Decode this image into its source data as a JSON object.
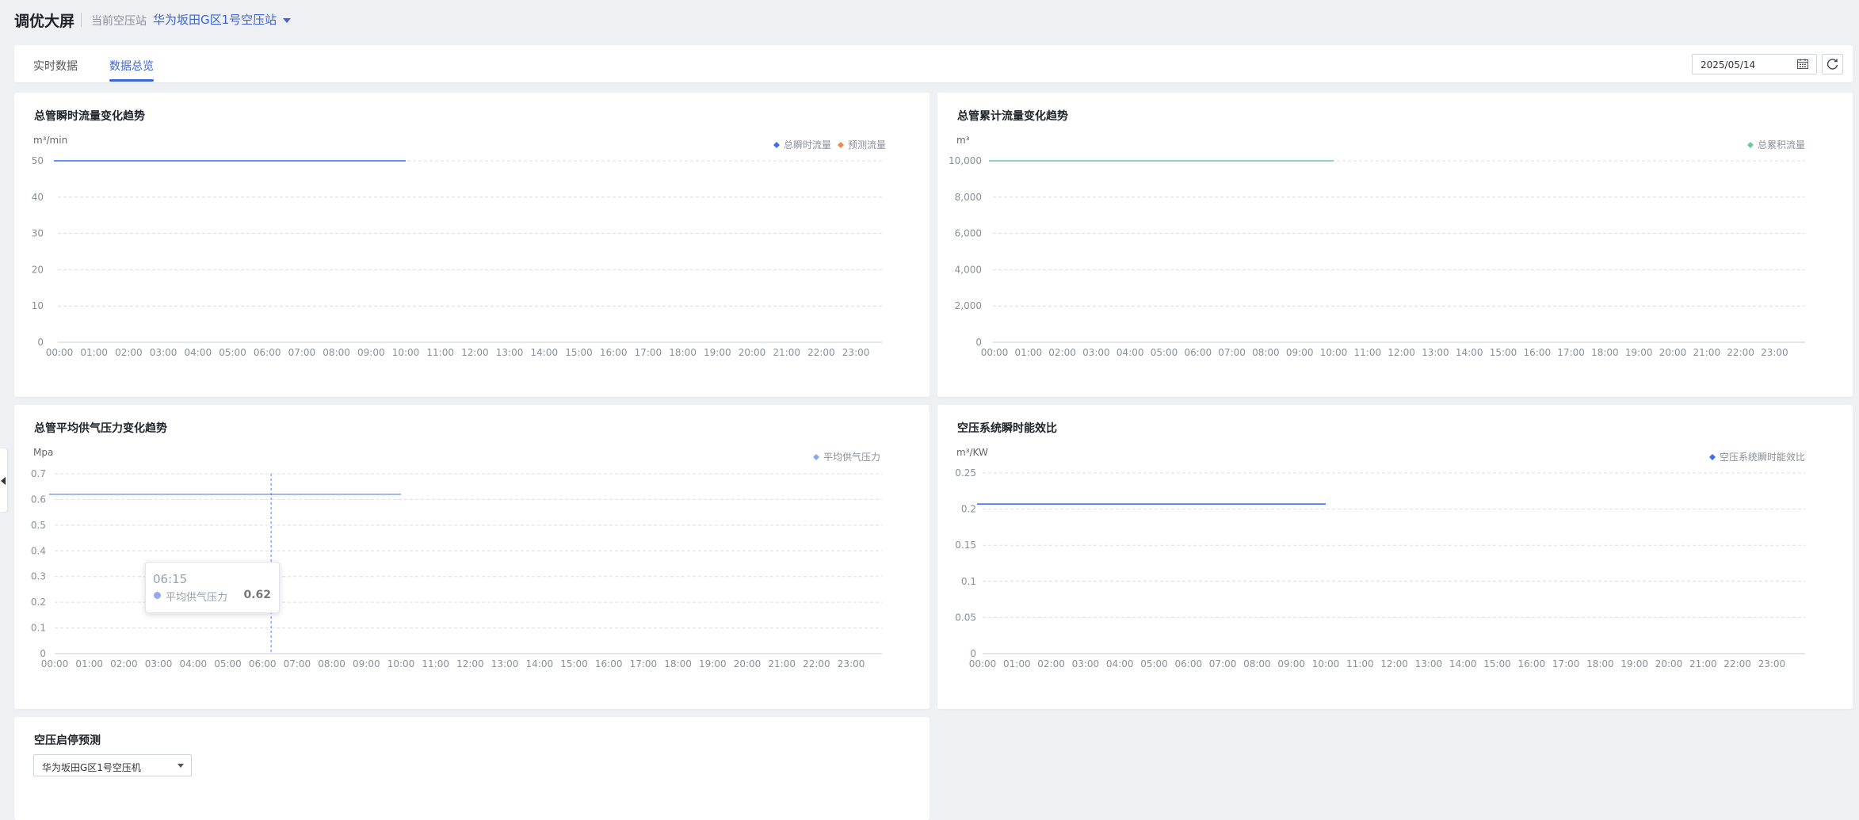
{
  "header": {
    "title": "调优大屏",
    "station_label": "当前空压站",
    "station_value": "华为坂田G区1号空压站"
  },
  "tabs": [
    {
      "label": "实时数据",
      "active": false
    },
    {
      "label": "数据总览",
      "active": true
    }
  ],
  "date_value": "2025/05/14",
  "icons": {
    "calendar": "calendar-icon",
    "refresh": "refresh-icon",
    "station_dropdown": "chevron-down-icon",
    "collapse": "chevron-left-icon"
  },
  "colors": {
    "accent": "#3b64d8",
    "flow": "#3b6ef0",
    "forecast": "#f08a4b",
    "cumulative": "#6cc9a1",
    "pressure": "#8aa6f2",
    "efficiency": "#3b6ef0"
  },
  "chart_data": [
    {
      "id": "flow",
      "type": "line",
      "title": "总管瞬时流量变化趋势",
      "ylabel": "m³/min",
      "ylim": [
        0,
        50
      ],
      "yticks": [
        "0",
        "10",
        "20",
        "30",
        "40",
        "50"
      ],
      "x_categories": [
        "00:00",
        "01:00",
        "02:00",
        "03:00",
        "04:00",
        "05:00",
        "06:00",
        "07:00",
        "08:00",
        "09:00",
        "10:00",
        "11:00",
        "12:00",
        "13:00",
        "14:00",
        "15:00",
        "16:00",
        "17:00",
        "18:00",
        "19:00",
        "20:00",
        "21:00",
        "22:00",
        "23:00"
      ],
      "legend": [
        {
          "name": "总瞬时流量",
          "color": "#3b6ef0"
        },
        {
          "name": "预测流量",
          "color": "#f08a4b"
        }
      ],
      "series": [
        {
          "name": "总瞬时流量",
          "color": "#3b6ef0",
          "x_start": "00:00",
          "x_end": "10:00",
          "value": 50
        }
      ],
      "grid": true
    },
    {
      "id": "cumulative",
      "type": "line",
      "title": "总管累计流量变化趋势",
      "ylabel": "m³",
      "ylim": [
        0,
        10000
      ],
      "yticks": [
        "0",
        "2,000",
        "4,000",
        "6,000",
        "8,000",
        "10,000"
      ],
      "x_categories": [
        "00:00",
        "01:00",
        "02:00",
        "03:00",
        "04:00",
        "05:00",
        "06:00",
        "07:00",
        "08:00",
        "09:00",
        "10:00",
        "11:00",
        "12:00",
        "13:00",
        "14:00",
        "15:00",
        "16:00",
        "17:00",
        "18:00",
        "19:00",
        "20:00",
        "21:00",
        "22:00",
        "23:00"
      ],
      "legend": [
        {
          "name": "总累积流量",
          "color": "#6cc9a1"
        }
      ],
      "series": [
        {
          "name": "总累积流量",
          "color": "#6cc9a1",
          "x_start": "00:00",
          "x_end": "10:00",
          "value": 10000
        }
      ],
      "grid": true
    },
    {
      "id": "pressure",
      "type": "line",
      "title": "总管平均供气压力变化趋势",
      "ylabel": "Mpa",
      "ylim": [
        0,
        0.7
      ],
      "yticks": [
        "0",
        "0.1",
        "0.2",
        "0.3",
        "0.4",
        "0.5",
        "0.6",
        "0.7"
      ],
      "x_categories": [
        "00:00",
        "01:00",
        "02:00",
        "03:00",
        "04:00",
        "05:00",
        "06:00",
        "07:00",
        "08:00",
        "09:00",
        "10:00",
        "11:00",
        "12:00",
        "13:00",
        "14:00",
        "15:00",
        "16:00",
        "17:00",
        "18:00",
        "19:00",
        "20:00",
        "21:00",
        "22:00",
        "23:00"
      ],
      "legend": [
        {
          "name": "平均供气压力",
          "color": "#8aa6f2"
        }
      ],
      "series": [
        {
          "name": "平均供气压力",
          "color": "#8aa6f2",
          "x_start": "00:00",
          "x_end": "10:00",
          "value": 0.62
        }
      ],
      "tooltip": {
        "time": "06:15",
        "series": "平均供气压力",
        "value": "0.62"
      },
      "grid": true
    },
    {
      "id": "efficiency",
      "type": "line",
      "title": "空压系统瞬时能效比",
      "ylabel": "m³/KW",
      "ylim": [
        0,
        0.25
      ],
      "yticks": [
        "0",
        "0.05",
        "0.1",
        "0.15",
        "0.2",
        "0.25"
      ],
      "x_categories": [
        "00:00",
        "01:00",
        "02:00",
        "03:00",
        "04:00",
        "05:00",
        "06:00",
        "07:00",
        "08:00",
        "09:00",
        "10:00",
        "11:00",
        "12:00",
        "13:00",
        "14:00",
        "15:00",
        "16:00",
        "17:00",
        "18:00",
        "19:00",
        "20:00",
        "21:00",
        "22:00",
        "23:00"
      ],
      "legend": [
        {
          "name": "空压系统瞬时能效比",
          "color": "#3b6ef0"
        }
      ],
      "series": [
        {
          "name": "空压系统瞬时能效比",
          "color": "#3b6ef0",
          "x_start": "00:00",
          "x_end": "10:00",
          "value": 0.207
        }
      ],
      "grid": true
    }
  ],
  "prediction": {
    "title": "空压启停预测",
    "select_value": "华为坂田G区1号空压机"
  }
}
